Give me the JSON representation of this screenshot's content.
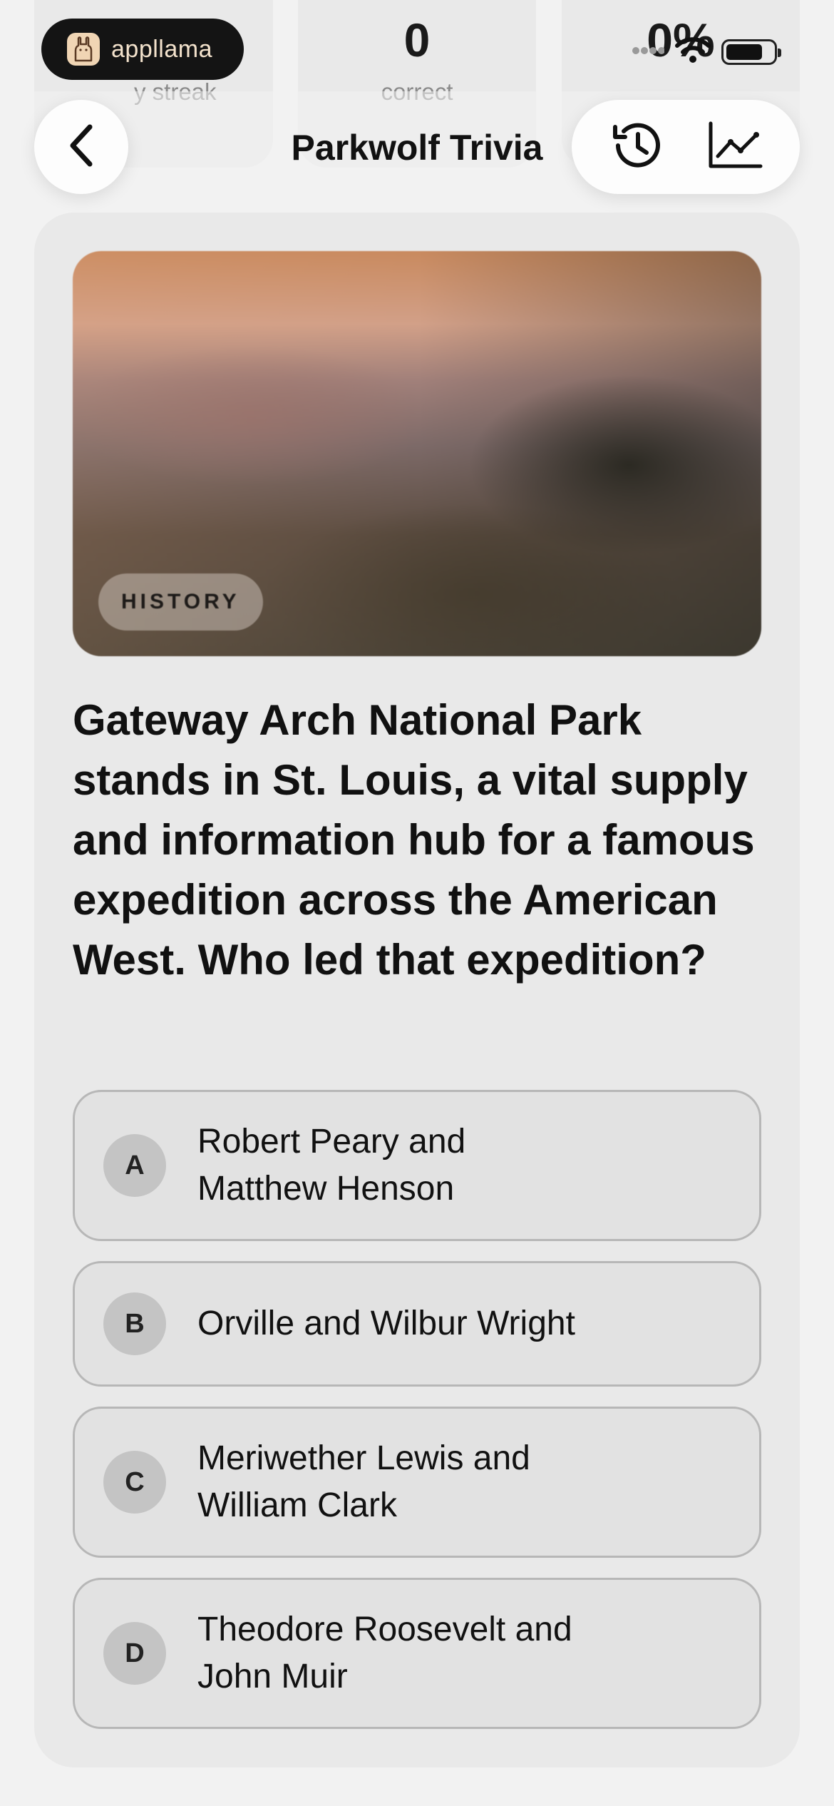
{
  "stats": [
    {
      "value": "",
      "label": "y streak"
    },
    {
      "value": "0",
      "label": "correct"
    },
    {
      "value": "0%",
      "label": ""
    }
  ],
  "applet": {
    "name": "appllama"
  },
  "header": {
    "title": "Parkwolf Trivia"
  },
  "question": {
    "category": "HISTORY",
    "text": "Gateway Arch National Park stands in St. Louis, a vital supply and information hub for a famous expedition across the American West. Who led that expedition?"
  },
  "options": [
    {
      "letter": "A",
      "text": "Robert Peary and\nMatthew Henson"
    },
    {
      "letter": "B",
      "text": "Orville and Wilbur Wright"
    },
    {
      "letter": "C",
      "text": "Meriwether Lewis and\nWilliam Clark"
    },
    {
      "letter": "D",
      "text": "Theodore Roosevelt and\nJohn Muir"
    }
  ],
  "colors": {
    "accent_green": "#5f7d52",
    "card_bg": "#e9e9e9",
    "page_bg": "#f2f2f2"
  },
  "icons": [
    "flame-icon",
    "check-circle-icon",
    "bar-chart-icon",
    "back-chevron-icon",
    "history-icon",
    "line-chart-icon",
    "llama-logo-icon",
    "wifi-icon",
    "battery-icon"
  ]
}
